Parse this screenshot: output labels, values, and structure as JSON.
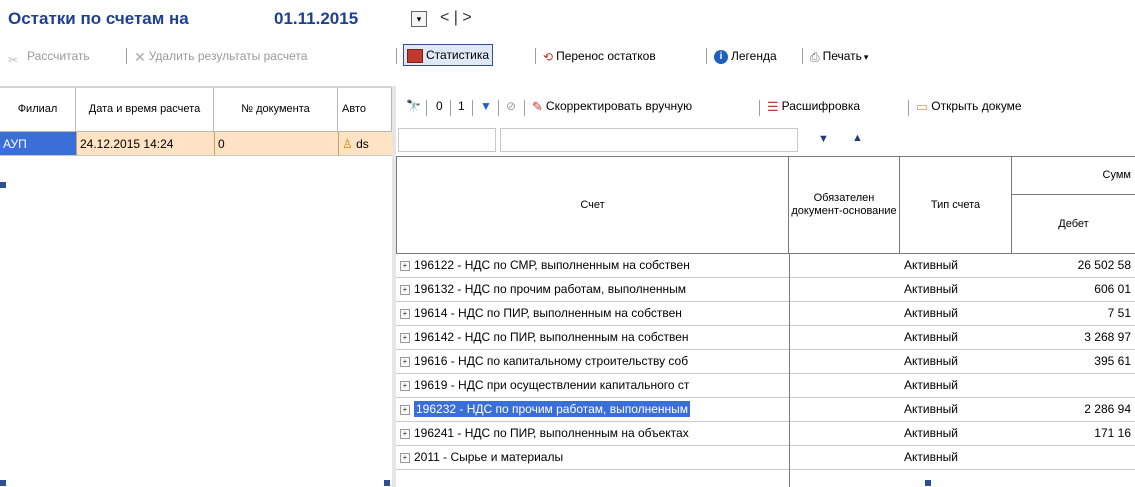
{
  "header": {
    "title": "Остатки по счетам на",
    "date": "01.11.2015",
    "nav": "< | >"
  },
  "toolbar1": {
    "recalc": "Рассчитать",
    "delete_results": "Удалить результаты расчета",
    "statistics": "Статистика",
    "transfer": "Перенос остатков",
    "legend": "Легенда",
    "print": "Печать"
  },
  "toolbar2": {
    "btn0": "0",
    "btn1": "1",
    "manual_correct": "Скорректировать вручную",
    "decode": "Расшифровка",
    "open_doc": "Открыть докуме"
  },
  "left_grid": {
    "columns": [
      "Филиал",
      "Дата и время расчета",
      "№ документа",
      "Авто"
    ],
    "rows": [
      {
        "branch": "АУП",
        "datetime": "24.12.2015 14:24",
        "doc_no": "0",
        "author": "ds"
      }
    ]
  },
  "right_grid": {
    "columns": {
      "account": "Счет",
      "required_doc": "Обязателен документ-основание",
      "account_type": "Тип счета",
      "sum_group": "Сумм",
      "debit": "Дебет"
    },
    "rows": [
      {
        "account": "196122 - НДС по СМР, выполненным на собствен",
        "type": "Активный",
        "debit": "26 502 58",
        "selected": false
      },
      {
        "account": "196132 - НДС по прочим работам, выполненным",
        "type": "Активный",
        "debit": "606 01",
        "selected": false
      },
      {
        "account": "19614 - НДС по ПИР, выполненным на собствен",
        "type": "Активный",
        "debit": "7 51",
        "selected": false
      },
      {
        "account": "196142 - НДС по ПИР, выполненным на собствен",
        "type": "Активный",
        "debit": "3 268 97",
        "selected": false
      },
      {
        "account": "19616 - НДС по капитальному строительству соб",
        "type": "Активный",
        "debit": "395 61",
        "selected": false
      },
      {
        "account": "19619 - НДС при осуществлении капитального ст",
        "type": "Активный",
        "debit": "",
        "selected": false
      },
      {
        "account": "196232 - НДС по прочим работам, выполненным",
        "type": "Активный",
        "debit": "2 286 94",
        "selected": true
      },
      {
        "account": "196241 - НДС по ПИР, выполненным на объектах",
        "type": "Активный",
        "debit": "171 16",
        "selected": false
      },
      {
        "account": "2011 - Сырье и материалы",
        "type": "Активный",
        "debit": "",
        "selected": false
      }
    ]
  },
  "colors": {
    "title": "#1f3f8f",
    "selected_bg": "#3a6fd8",
    "row_highlight": "#fde2c4",
    "accent_blue": "#1f5fbf"
  }
}
